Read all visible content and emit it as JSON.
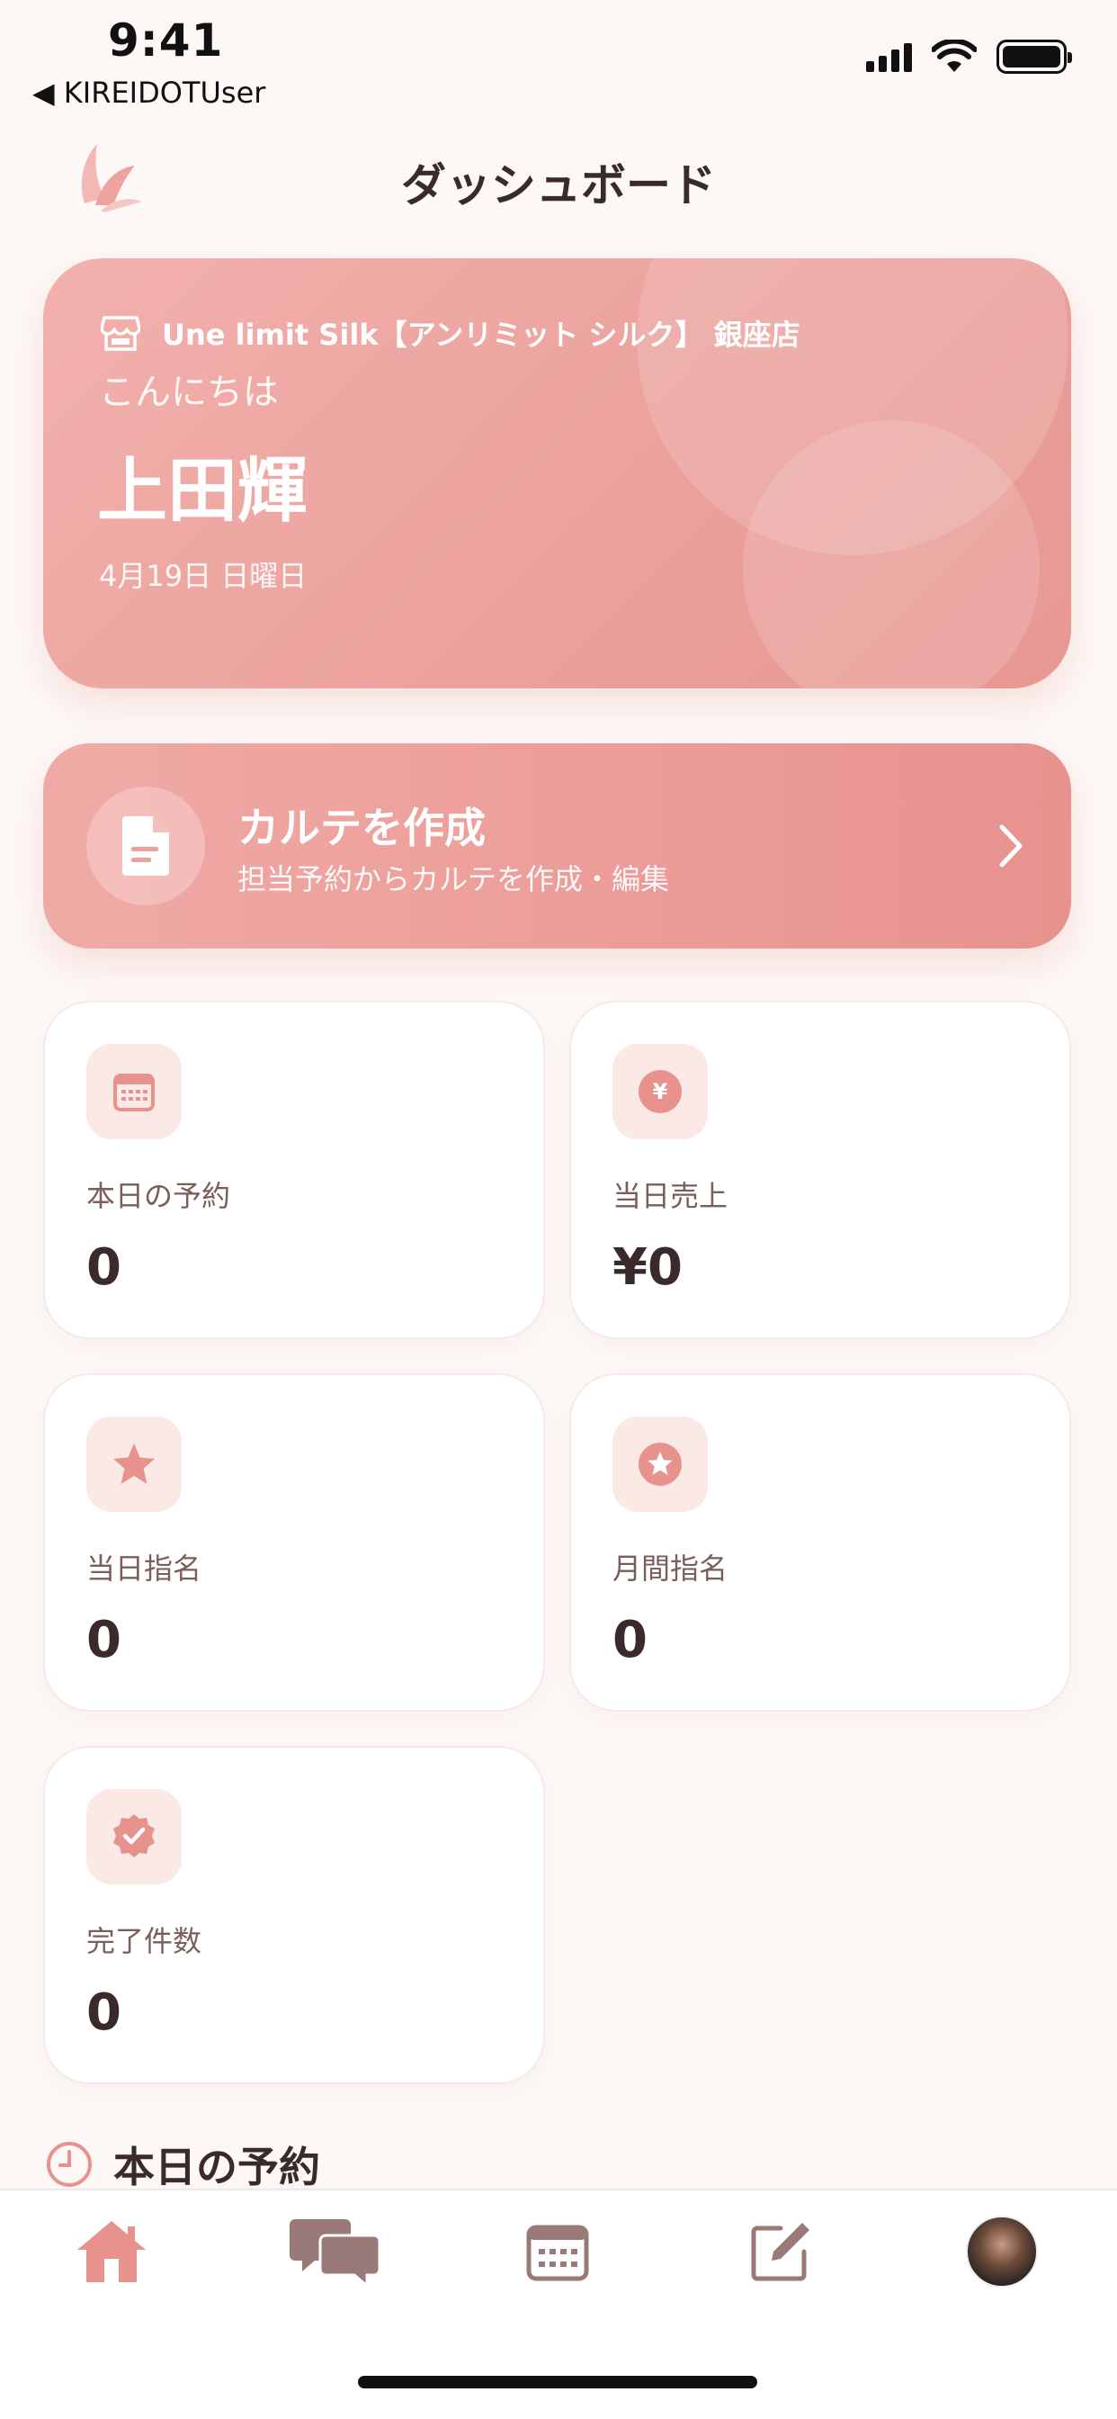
{
  "status_bar": {
    "time": "9:41",
    "back_label": "◀ KIREIDOTUser"
  },
  "header": {
    "title": "ダッシュボード",
    "logo_icon": "lotus-logo-icon"
  },
  "greeting": {
    "shop_name": "Une limit Silk【アンリミット シルク】 銀座店",
    "hello": "こんにちは",
    "user_name": "上田輝",
    "date": "4月19日 日曜日"
  },
  "karte": {
    "title": "カルテを作成",
    "subtitle": "担当予約からカルテを作成・編集"
  },
  "stats": [
    {
      "label": "本日の予約",
      "value": "0",
      "icon": "calendar-icon"
    },
    {
      "label": "当日売上",
      "value": "¥0",
      "icon": "yen-icon",
      "icon_text": "¥"
    },
    {
      "label": "当日指名",
      "value": "0",
      "icon": "star-icon"
    },
    {
      "label": "月間指名",
      "value": "0",
      "icon": "star-circle-icon"
    },
    {
      "label": "完了件数",
      "value": "0",
      "icon": "check-badge-icon"
    }
  ],
  "section": {
    "title": "本日の予約"
  },
  "tabs": [
    {
      "name": "home",
      "icon": "home-icon",
      "active": true
    },
    {
      "name": "chat",
      "icon": "chat-icon"
    },
    {
      "name": "calendar",
      "icon": "calendar-icon"
    },
    {
      "name": "edit",
      "icon": "edit-icon"
    },
    {
      "name": "profile",
      "icon": "avatar"
    }
  ],
  "colors": {
    "accent": "#e8928e",
    "accent_light": "#fbe9e6",
    "text_dark": "#3a2a2a",
    "background": "#fdf8f6"
  }
}
